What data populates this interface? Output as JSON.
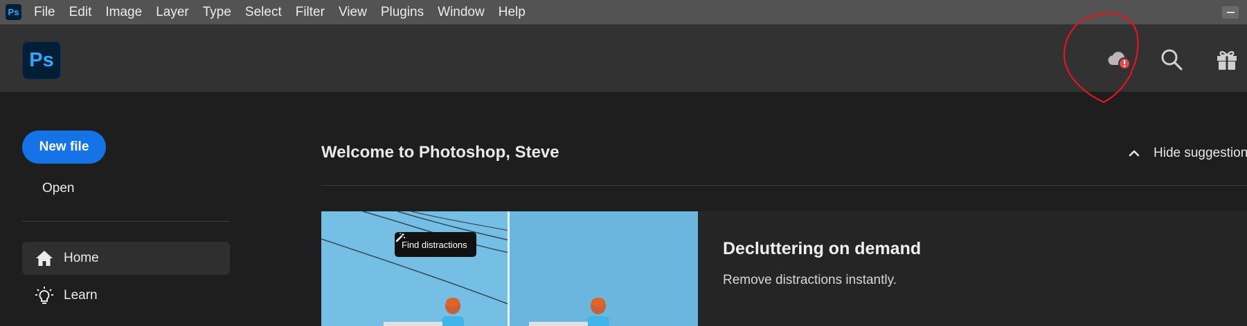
{
  "menubar": {
    "app_icon": "Ps",
    "items": [
      "File",
      "Edit",
      "Image",
      "Layer",
      "Type",
      "Select",
      "Filter",
      "View",
      "Plugins",
      "Window",
      "Help"
    ]
  },
  "header": {
    "logo": "Ps",
    "icons": [
      "cloud-alert-icon",
      "search-icon",
      "gift-icon"
    ]
  },
  "nav": {
    "new_file": "New file",
    "open": "Open",
    "items": [
      {
        "label": "Home",
        "icon": "home-icon",
        "active": true
      },
      {
        "label": "Learn",
        "icon": "lightbulb-icon",
        "active": false
      }
    ]
  },
  "main": {
    "welcome": "Welcome to Photoshop, Steve",
    "hide_suggestions": "Hide suggestion",
    "card": {
      "button": "Find distractions",
      "title": "Decluttering on demand",
      "subtitle": "Remove distractions instantly."
    }
  },
  "colors": {
    "accent": "#1473e6",
    "ps_blue": "#31a8ff",
    "ps_dark": "#001e36",
    "alert_red": "#e34850",
    "annotation_red": "#e8141b"
  }
}
